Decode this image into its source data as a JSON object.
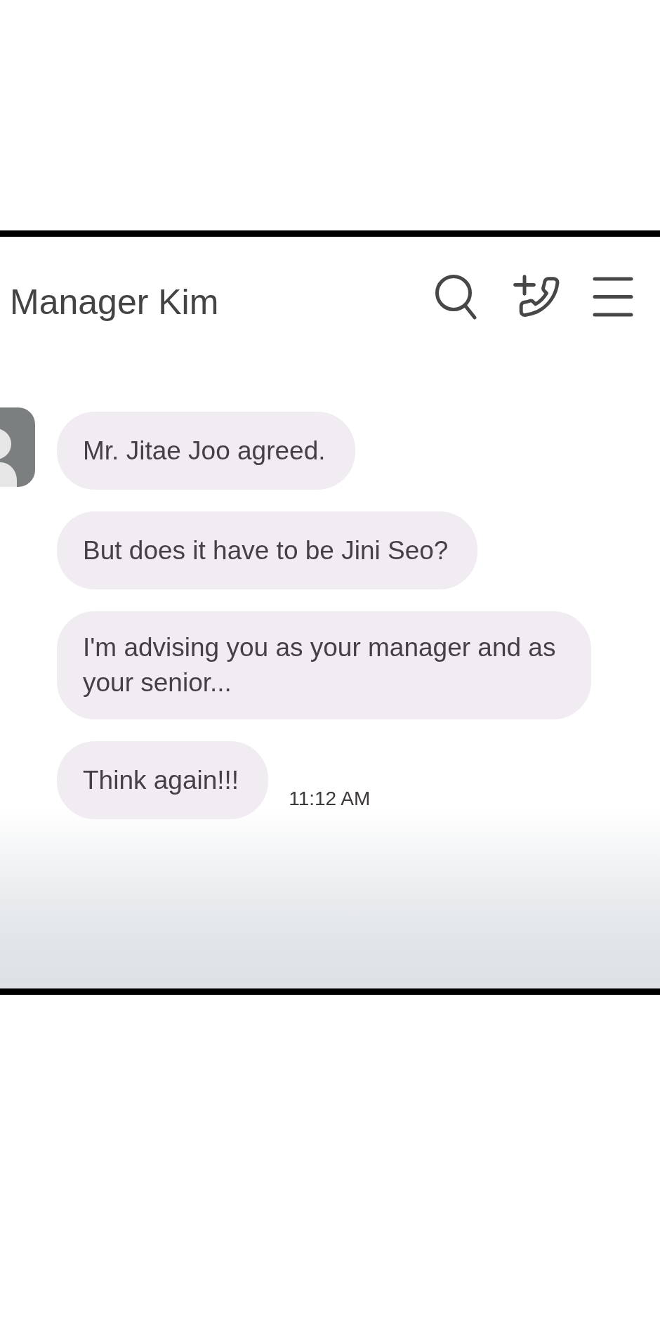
{
  "header": {
    "title": "Manager Kim"
  },
  "messages": [
    {
      "text": "Mr. Jitae Joo agreed."
    },
    {
      "text": "But does it have to be Jini Seo?"
    },
    {
      "text": "I'm advising you as your manager and as your senior..."
    },
    {
      "text": "Think again!!!",
      "time": "11:12 AM"
    }
  ]
}
